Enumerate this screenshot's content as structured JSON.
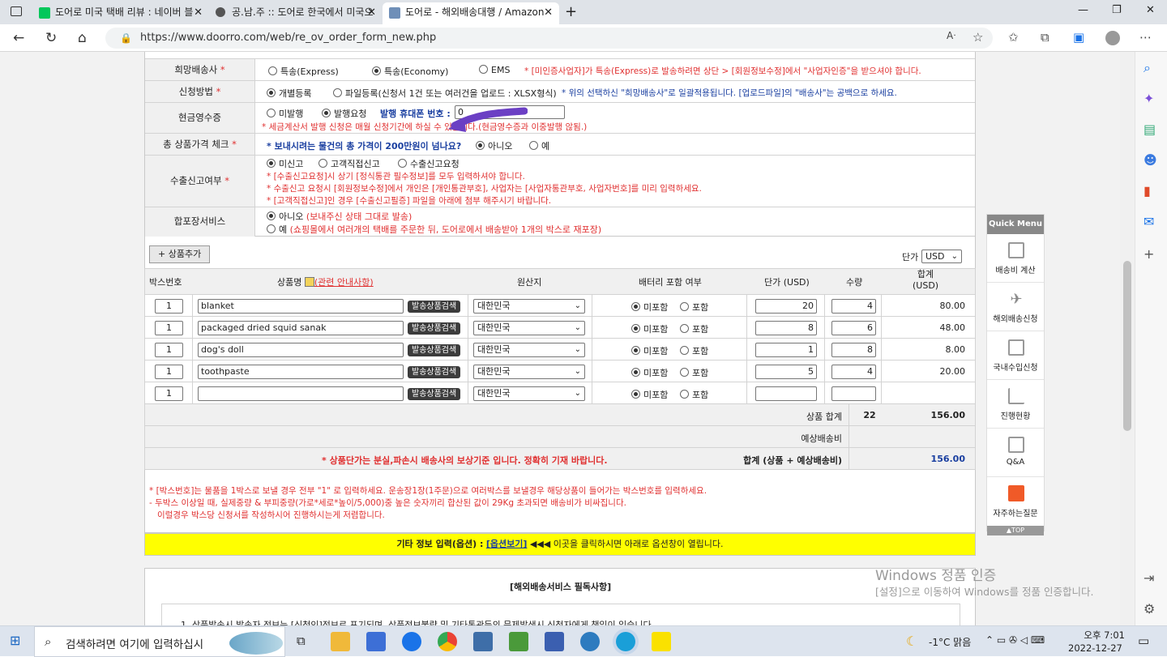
{
  "browser": {
    "tabs": [
      {
        "title": "도어로 미국 택배 리뷰 : 네이버 블",
        "close": "✕"
      },
      {
        "title": "공.남.주 :: 도어로 한국에서 미국으",
        "close": "✕"
      },
      {
        "title": "도어로 - 해외배송대행 / Amazon",
        "close": "✕"
      }
    ],
    "new_tab": "+",
    "url": "https://www.doorro.com/web/re_ov_order_form_new.php",
    "win_min": "—",
    "win_max": "❐",
    "win_close": "✕"
  },
  "form": {
    "carrier": {
      "label": "희망배송사",
      "req": "*",
      "opt1": "특송(Express)",
      "opt2": "특송(Economy)",
      "opt3": "EMS",
      "note": "* [미인증사업자]가 특송(Express)로 발송하려면 상단 > [회원정보수정]에서 \"사업자인증\"을 받으셔야 합니다."
    },
    "method": {
      "label": "신청방법",
      "req": "*",
      "opt1": "개별등록",
      "opt2": "파일등록(신청서 1건 또는 여러건을 업로드 : XLSX형식)",
      "note": "* 위의 선택하신 \"희망배송사\"로 일괄적용됩니다. [업로드파일]의 \"배송사\"는 공백으로 하세요."
    },
    "receipt": {
      "label": "현금영수증",
      "opt1": "미발행",
      "opt2": "발행요청",
      "phone_label": "발행 휴대폰 번호 :",
      "phone_value": "0",
      "note": "* 세금계산서 발행 신청은 매월 신청기간에 하실 수 있습니다.(현금영수증과 이중발행 않됨.)"
    },
    "price_check": {
      "label": "총 상품가격 체크",
      "req": "*",
      "question": "* 보내시려는 물건의 총 가격이 200만원이 넘나요?",
      "opt1": "아니오",
      "opt2": "예"
    },
    "export": {
      "label": "수출신고여부",
      "req": "*",
      "opt1": "미신고",
      "opt2": "고객직접신고",
      "opt3": "수출신고요청",
      "note1": "* [수출신고요청]시 상기 [정식통관 필수정보]를 모두 입력하셔야 합니다.",
      "note2": "* 수출신고 요청시 [회원정보수정]에서 개인은 [개인통관부호], 사업자는 [사업자통관부호, 사업자번호]를 미리 입력하세요.",
      "note3": "* [고객직접신고]인 경우 [수출신고필증] 파일을 아래에 첨부 해주시기 바랍니다."
    },
    "repack": {
      "label": "합포장서비스",
      "opt1": "아니오",
      "opt1_note": "(보내주신 상태 그대로 발송)",
      "opt2": "예",
      "opt2_note": "(쇼핑몰에서 여러개의 택배를 주문한 뒤, 도어로에서 배송받아 1개의 박스로 재포장)"
    }
  },
  "items_section": {
    "add_button": "+ 상품추가",
    "currency_label": "단가",
    "currency": "USD",
    "headers": {
      "box": "박스번호",
      "name": "상품명",
      "name_link": "(관련 안내사항)",
      "origin": "원산지",
      "battery": "배터리 포함 여부",
      "price": "단가 (USD)",
      "qty": "수량",
      "total": "합계\n(USD)"
    },
    "search_btn": "발송상품검색",
    "battery_no": "미포함",
    "battery_yes": "포함",
    "rows": [
      {
        "box": "1",
        "name": "blanket",
        "origin": "대한민국",
        "price": "20",
        "qty": "4",
        "total": "80.00"
      },
      {
        "box": "1",
        "name": "packaged dried squid sanak",
        "origin": "대한민국",
        "price": "8",
        "qty": "6",
        "total": "48.00"
      },
      {
        "box": "1",
        "name": "dog's doll",
        "origin": "대한민국",
        "price": "1",
        "qty": "8",
        "total": "8.00"
      },
      {
        "box": "1",
        "name": "toothpaste",
        "origin": "대한민국",
        "price": "5",
        "qty": "4",
        "total": "20.00"
      },
      {
        "box": "1",
        "name": "",
        "origin": "대한민국",
        "price": "",
        "qty": "",
        "total": ""
      }
    ],
    "sum_label": "상품 합계",
    "sum_qty": "22",
    "sum_total": "156.00",
    "ship_label": "예상배송비",
    "notice": "* 상품단가는 분실,파손시 배송사의 보상기준 입니다. 정확히 기재 바랍니다.",
    "grand_label": "합계 (상품 + 예상배송비)",
    "grand_total": "156.00"
  },
  "box_notes": {
    "l1": "* [박스번호]는 물품을 1박스로 보낼 경우 전부 \"1\" 로 입력하세요. 운송장1장(1주문)으로 여러박스를 보낼경우 해당상품이 들어가는 박스번호를 입력하세요.",
    "l2": " - 두박스 이상일 때, 실제중량 & 부피중량(가로*세로*높이/5,000)중 높은 숫자끼리 합산된 값이 29Kg 초과되면 배송비가 비싸집니다.",
    "l3": "   이럴경우 박스당 신청서를 작성하시어 진행하시는게 저렴합니다."
  },
  "options_bar": {
    "label": "기타 정보 입력(옵션) :",
    "link": "[옵션보기]",
    "arrows": "◀◀◀",
    "text": "이곳을 클릭하시면 아래로 옵션창이 열립니다."
  },
  "notice_box": {
    "title": "[해외배송서비스 필독사항]",
    "line1": "1. 상품발송시 발송자 정보는 [신청인]정보로 표기되며, 상품정보불량 및 기타통관등의 문제발생시 신청자에게 책임이 있습니다."
  },
  "quick_menu": {
    "title": "Quick Menu",
    "items": [
      "배송비 계산",
      "해외배송신청",
      "국내수입신청",
      "진행현황",
      "Q&A",
      "자주하는질문"
    ],
    "top": "▲TOP"
  },
  "watermark": {
    "l1": "Windows 정품 인증",
    "l2": "[설정]으로 이동하여 Windows를 정품 인증합니다."
  },
  "taskbar": {
    "search": "검색하려면 여기에 입력하십시",
    "weather": "-1°C 맑음",
    "time": "오후 7:01",
    "date": "2022-12-27"
  }
}
